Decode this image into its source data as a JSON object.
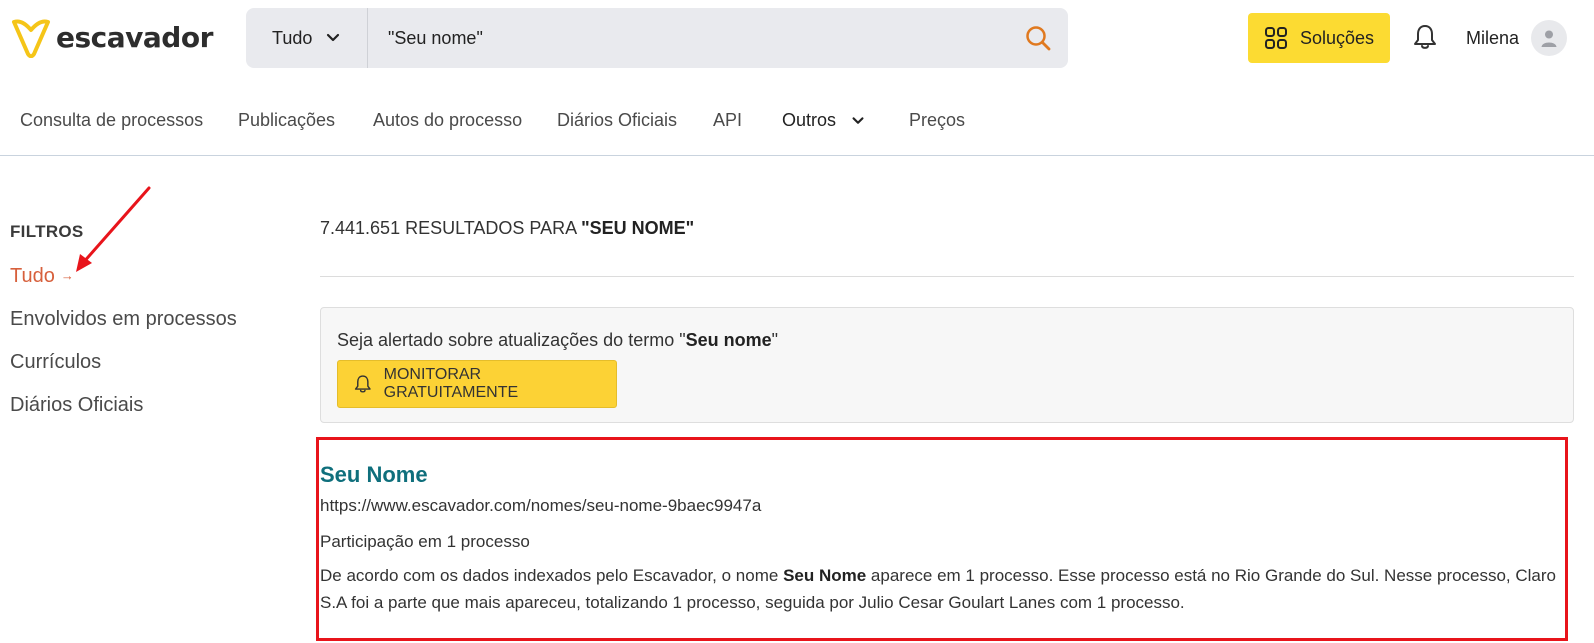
{
  "header": {
    "logo_text": "escavador",
    "search": {
      "category": "Tudo",
      "query": "\"Seu nome\""
    },
    "solucoes_label": "Soluções",
    "user_name": "Milena"
  },
  "nav": {
    "items": [
      {
        "label": "Consulta de processos"
      },
      {
        "label": "Publicações"
      },
      {
        "label": "Autos do processo"
      },
      {
        "label": "Diários Oficiais"
      },
      {
        "label": "API"
      },
      {
        "label": "Outros"
      },
      {
        "label": "Preços"
      }
    ]
  },
  "sidebar": {
    "title": "FILTROS",
    "items": [
      {
        "label": "Tudo",
        "active": true
      },
      {
        "label": "Envolvidos em processos"
      },
      {
        "label": "Currículos"
      },
      {
        "label": "Diários Oficiais"
      }
    ]
  },
  "results": {
    "count_prefix": "7.441.651 RESULTADOS PARA ",
    "count_term": "\"SEU NOME\"",
    "alert": {
      "text_prefix": "Seja alertado sobre atualizações do termo \"",
      "term": "Seu nome",
      "text_suffix": "\"",
      "button_label": "MONITORAR GRATUITAMENTE"
    },
    "items": [
      {
        "title": "Seu Nome",
        "url": "https://www.escavador.com/nomes/seu-nome-9baec9947a",
        "subtitle": "Participação em 1 processo",
        "desc_part1": "De acordo com os dados indexados pelo Escavador, o nome ",
        "desc_bold": "Seu Nome",
        "desc_part2": " aparece em 1 processo. Esse processo está no Rio Grande do Sul. Nesse processo, Claro S.A foi a parte que mais apareceu, totalizando 1 processo, seguida por Julio Cesar Goulart Lanes com 1 processo."
      }
    ]
  },
  "colors": {
    "brand_yellow": "#fcdb32",
    "active_filter": "#d7603c",
    "result_title": "#0f6f7c",
    "annotation_red": "#e8141b"
  }
}
